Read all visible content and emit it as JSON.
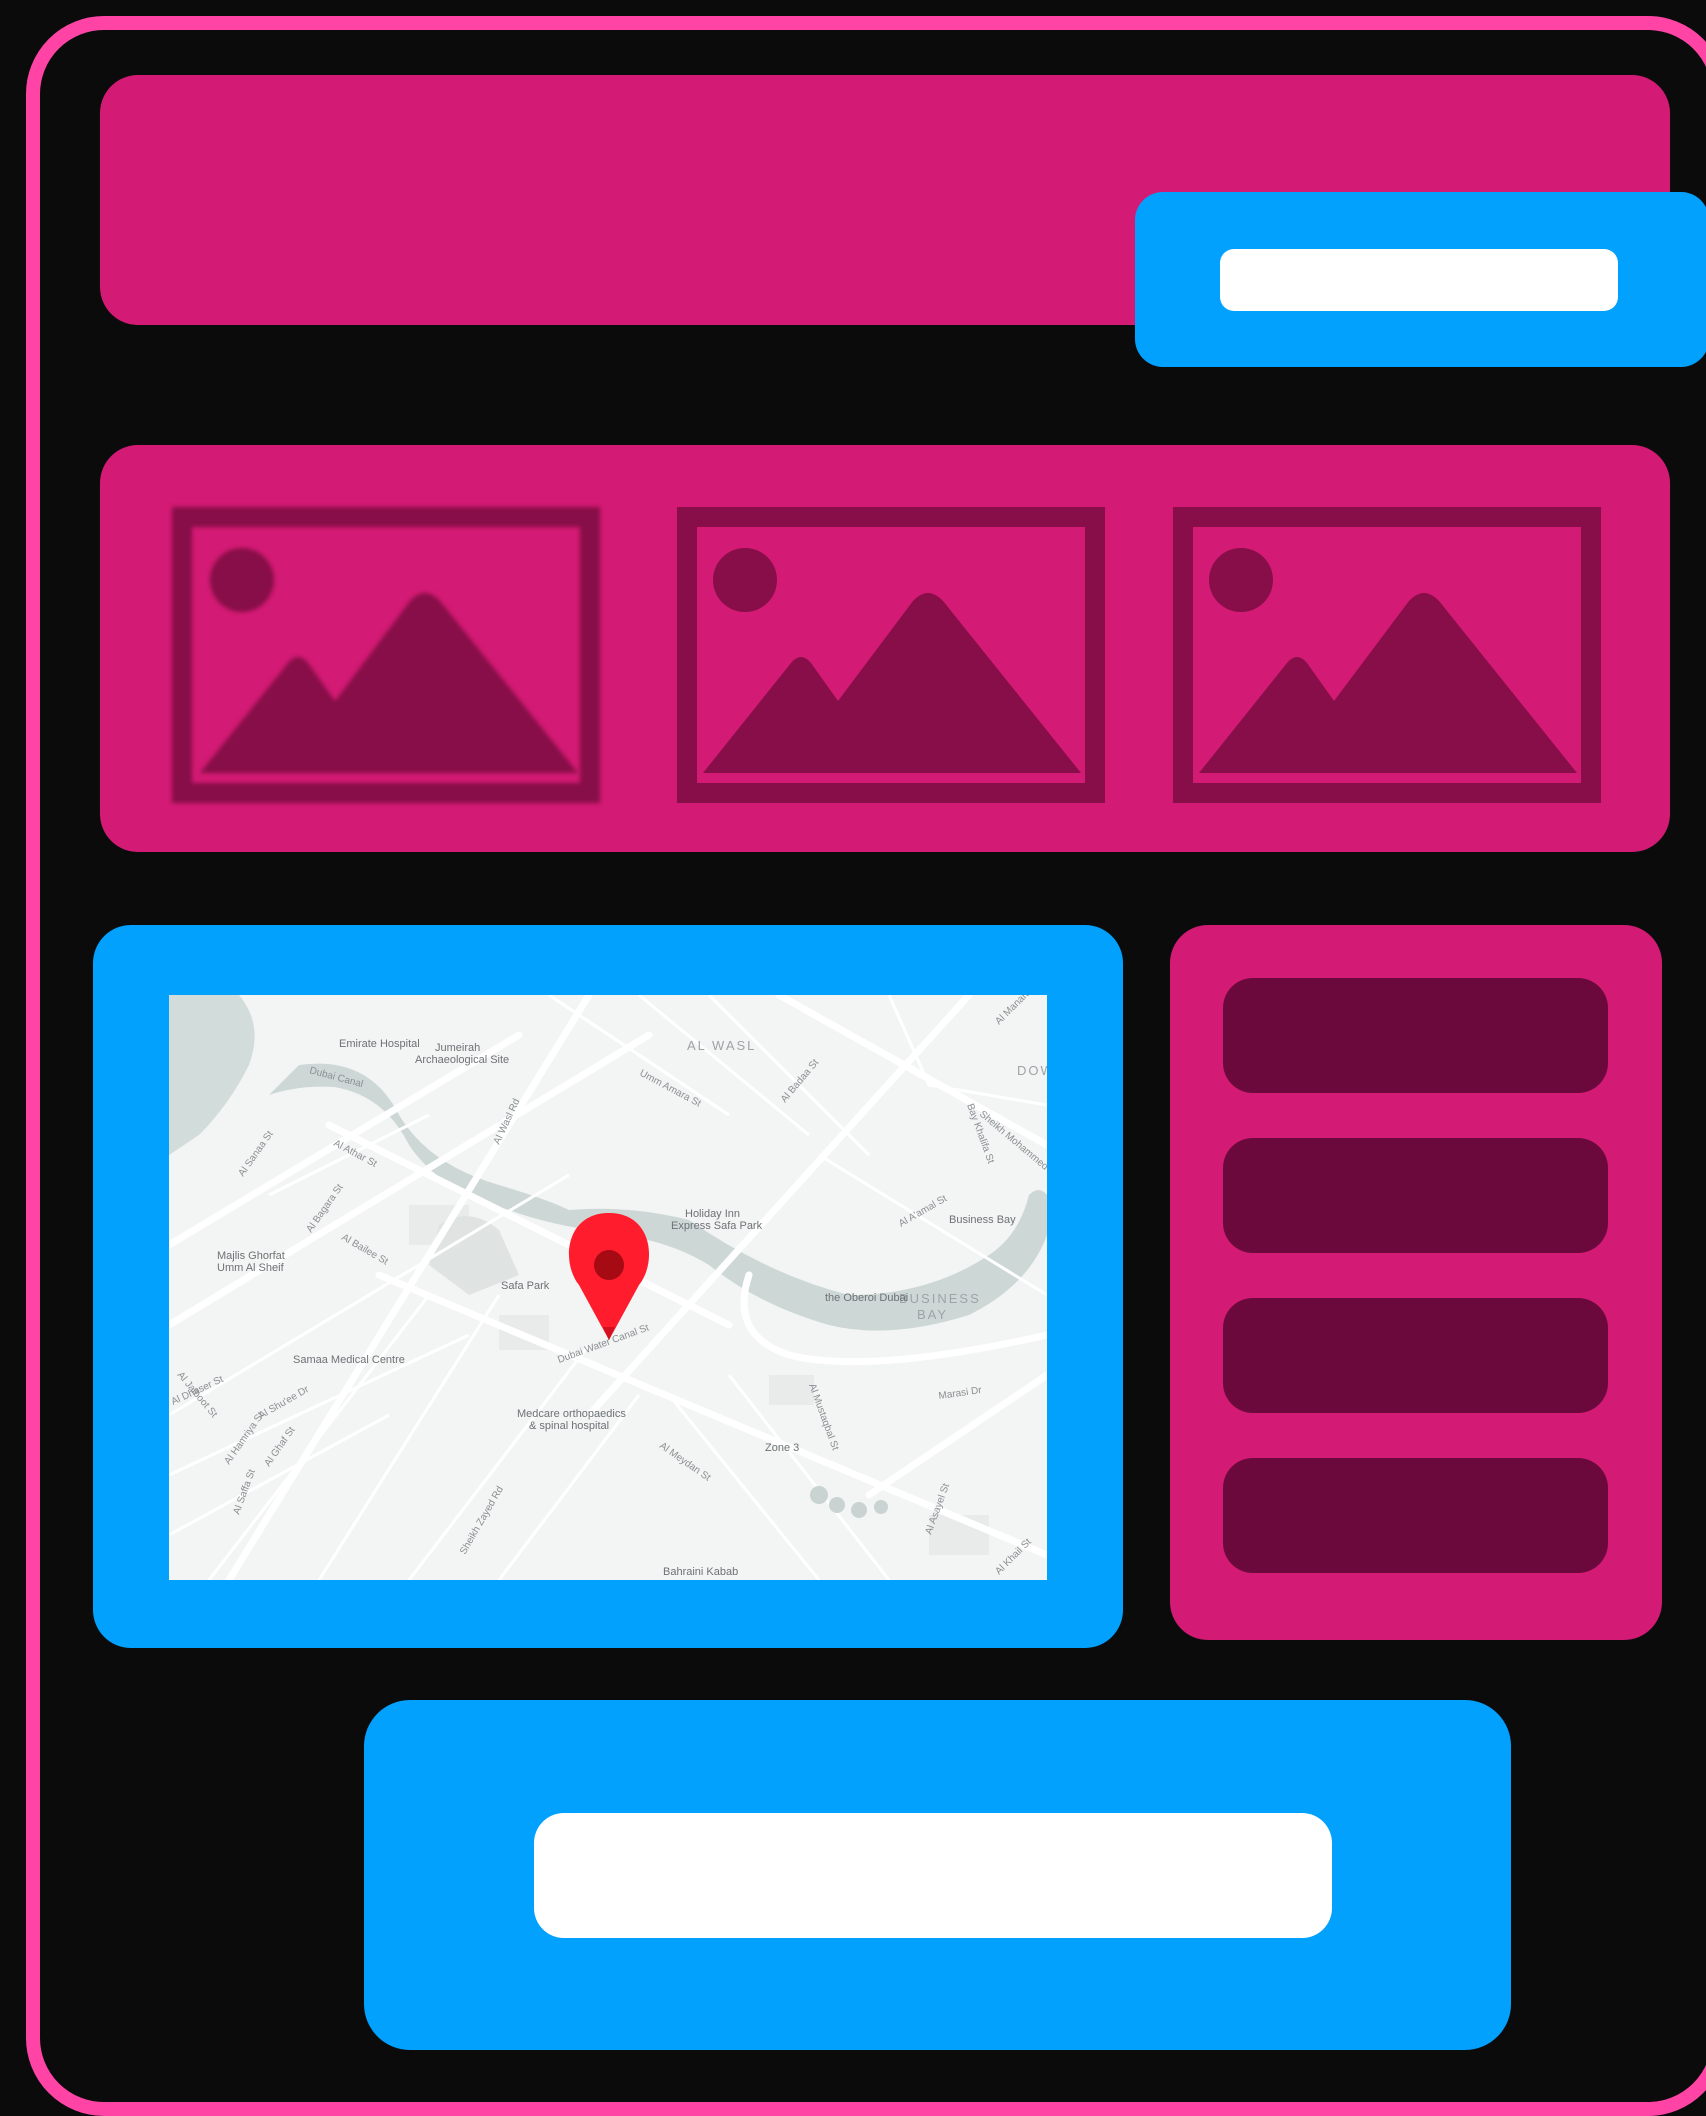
{
  "theme": {
    "background": "#0b0b0c",
    "frame_border": "#ff44a6",
    "panel_magenta": "#d31a74",
    "panel_blue": "#02a1fe",
    "side_item": "#6c093c",
    "image_placeholder_icon": "#870e48",
    "pin_color": "#ff1d2d"
  },
  "header": {
    "search": {
      "value": "",
      "placeholder": ""
    }
  },
  "gallery": {
    "images": [
      {
        "icon": "image-placeholder-icon"
      },
      {
        "icon": "image-placeholder-icon"
      },
      {
        "icon": "image-placeholder-icon"
      }
    ]
  },
  "map": {
    "marker_icon": "map-pin-icon",
    "area_labels": [
      "AL WASL",
      "BUSINESS",
      "BAY",
      "DOW"
    ],
    "places": [
      "Emirate Hospital",
      "Jumeirah",
      "Archaeological Site",
      "Holiday Inn",
      "Express Safa Park",
      "Safa Park",
      "Majlis Ghorfat",
      "Umm Al Sheif",
      "Samaa Medical Centre",
      "Medcare orthopaedics",
      "& spinal hospital",
      "the Oberoi Dubai",
      "Business Bay",
      "Zone 3",
      "Bahraini Kabab"
    ],
    "streets": [
      "Dubai Canal",
      "Al Wasl Rd",
      "Umm Amara St",
      "Al Badaa St",
      "Al Athar St",
      "Al Bagara St",
      "Al Bailee St",
      "Al A'amal St",
      "Dubai Water Canal St",
      "Al Meydan St",
      "Marasi Dr",
      "Sheikh Zayed Rd",
      "Al Asayel St",
      "Bay Khalifa St",
      "Al Khail St",
      "Al Saffa St",
      "Al Mustaqbal St",
      "Al Manara Rd",
      "Sheikh Mohammed bin",
      "Al Shu'ee Dr",
      "Al Jalboot St",
      "Al Dhaser St",
      "Al Hamriya St",
      "Al Ghaf St",
      "Al Sanaa St"
    ]
  },
  "sidebar": {
    "items": [
      {
        "label": ""
      },
      {
        "label": ""
      },
      {
        "label": ""
      },
      {
        "label": ""
      }
    ]
  },
  "cta": {
    "label": ""
  }
}
